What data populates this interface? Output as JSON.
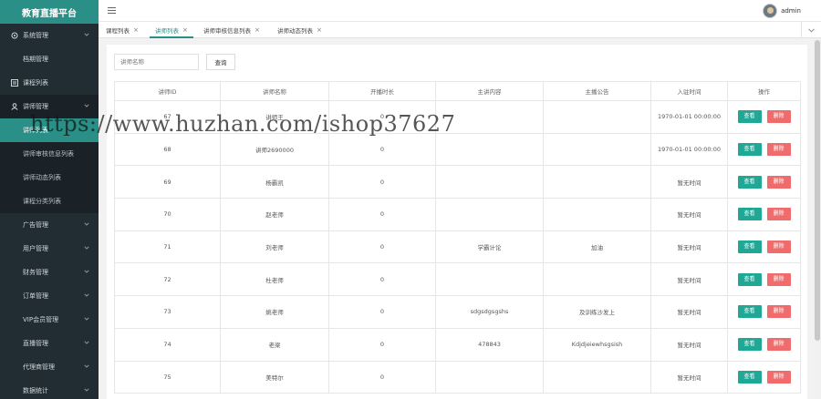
{
  "app": {
    "logo": "教育直播平台"
  },
  "colors": {
    "accent": "#2a8f86",
    "sidebar": "#222c33",
    "view_button": "#1ea895",
    "delete_button": "#f06c6c"
  },
  "sidebar": {
    "items": [
      {
        "label": "系统管理",
        "icon": "gear-icon",
        "type": "top",
        "chevron": true
      },
      {
        "label": "档期管理",
        "icon": "",
        "type": "indent",
        "chevron": false
      },
      {
        "label": "课程列表",
        "icon": "list-icon",
        "type": "top",
        "chevron": false
      },
      {
        "label": "讲师管理",
        "icon": "user-icon",
        "type": "top-open",
        "chevron": true
      },
      {
        "label": "讲师列表",
        "icon": "",
        "type": "sub-active",
        "chevron": false
      },
      {
        "label": "讲师审核信息列表",
        "icon": "",
        "type": "sub",
        "chevron": false
      },
      {
        "label": "讲师动态列表",
        "icon": "",
        "type": "sub",
        "chevron": false
      },
      {
        "label": "课程分类列表",
        "icon": "",
        "type": "sub",
        "chevron": false
      },
      {
        "label": "广告管理",
        "icon": "",
        "type": "indent",
        "chevron": true
      },
      {
        "label": "用户管理",
        "icon": "",
        "type": "indent",
        "chevron": true
      },
      {
        "label": "财务管理",
        "icon": "",
        "type": "indent",
        "chevron": true
      },
      {
        "label": "订单管理",
        "icon": "",
        "type": "indent",
        "chevron": true
      },
      {
        "label": "VIP会员管理",
        "icon": "",
        "type": "indent",
        "chevron": true
      },
      {
        "label": "直播管理",
        "icon": "",
        "type": "indent",
        "chevron": true
      },
      {
        "label": "代理商管理",
        "icon": "",
        "type": "indent",
        "chevron": true
      },
      {
        "label": "数据统计",
        "icon": "",
        "type": "indent",
        "chevron": true
      }
    ]
  },
  "header": {
    "user_name": "admin"
  },
  "tabs": [
    {
      "label": "课程列表"
    },
    {
      "label": "讲师列表"
    },
    {
      "label": "讲师审核信息列表"
    },
    {
      "label": "讲师动态列表"
    }
  ],
  "search": {
    "placeholder": "讲师名称",
    "button_label": "查询"
  },
  "table": {
    "columns": [
      "讲师ID",
      "讲师名称",
      "开播时长",
      "主讲内容",
      "主播公告",
      "入驻时间",
      "操作"
    ],
    "rows": [
      {
        "id": "67",
        "name": "讲师王",
        "duration": "0",
        "content": "",
        "notice": "",
        "joined": "1970-01-01 00:00:00"
      },
      {
        "id": "68",
        "name": "讲师2690000",
        "duration": "0",
        "content": "",
        "notice": "",
        "joined": "1970-01-01 00:00:00"
      },
      {
        "id": "69",
        "name": "杨霸凯",
        "duration": "0",
        "content": "",
        "notice": "",
        "joined": "暂无时间"
      },
      {
        "id": "70",
        "name": "赵老师",
        "duration": "0",
        "content": "",
        "notice": "",
        "joined": "暂无时间"
      },
      {
        "id": "71",
        "name": "刘老师",
        "duration": "0",
        "content": "学霸计论",
        "notice": "加油",
        "joined": "暂无时间"
      },
      {
        "id": "72",
        "name": "杜老师",
        "duration": "0",
        "content": "",
        "notice": "",
        "joined": "暂无时间"
      },
      {
        "id": "73",
        "name": "姚老师",
        "duration": "0",
        "content": "sdgsdgsgshs",
        "notice": "及训练沙发上",
        "joined": "暂无时间"
      },
      {
        "id": "74",
        "name": "老梁",
        "duration": "0",
        "content": "478843",
        "notice": "Kdjdjeiewhsgsish",
        "joined": "暂无时间"
      },
      {
        "id": "75",
        "name": "美特尔",
        "duration": "0",
        "content": "",
        "notice": "",
        "joined": "暂无时间"
      }
    ],
    "view_label": "查看",
    "delete_label": "删除"
  },
  "watermark": "https://www.huzhan.com/ishop37627"
}
